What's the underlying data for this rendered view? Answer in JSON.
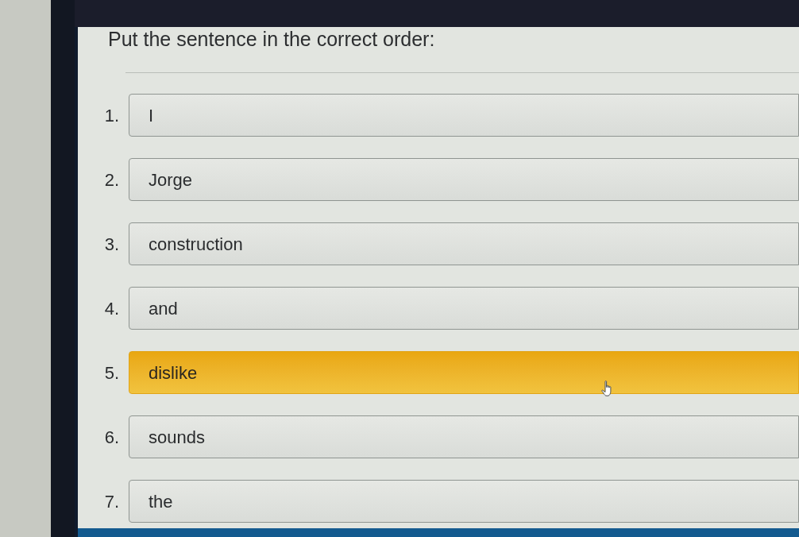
{
  "instruction": "Put the sentence in the correct order:",
  "items": [
    {
      "number": "1.",
      "word": "I",
      "selected": false
    },
    {
      "number": "2.",
      "word": "Jorge",
      "selected": false
    },
    {
      "number": "3.",
      "word": "construction",
      "selected": false
    },
    {
      "number": "4.",
      "word": "and",
      "selected": false
    },
    {
      "number": "5.",
      "word": "dislike",
      "selected": true
    },
    {
      "number": "6.",
      "word": "sounds",
      "selected": false
    },
    {
      "number": "7.",
      "word": "the",
      "selected": false
    }
  ]
}
